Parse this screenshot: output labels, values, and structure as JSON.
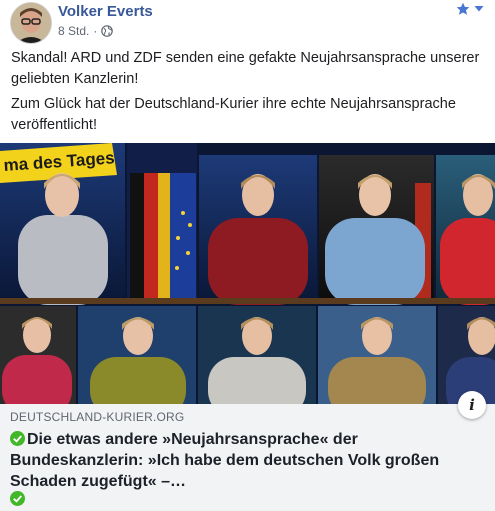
{
  "post": {
    "author": "Volker Everts",
    "time": "8 Std.",
    "separator": "·",
    "paragraphs": [
      "Skandal! ARD und ZDF senden eine gefakte Neujahrsansprache unserer geliebten Kanzlerin!",
      "Zum Glück hat der Deutschland-Kurier ihre echte Neujahrsansprache veröffentlicht!"
    ]
  },
  "media": {
    "banner_text": "ma des Tages"
  },
  "link_preview": {
    "domain": "DEUTSCHLAND-KURIER.ORG",
    "title": "Die etwas andere »Neujahrsansprache« der Bundeskanzlerin: »Ich habe dem deutschen Volk großen Schaden zugefügt« –…",
    "info_glyph": "i"
  },
  "colors": {
    "link_blue": "#385898",
    "verified_green": "#42b72a",
    "star_blue": "#4a76d1"
  },
  "icons": [
    "avatar",
    "globe-icon",
    "star-icon",
    "caret-down-icon",
    "check-icon",
    "info-icon"
  ]
}
